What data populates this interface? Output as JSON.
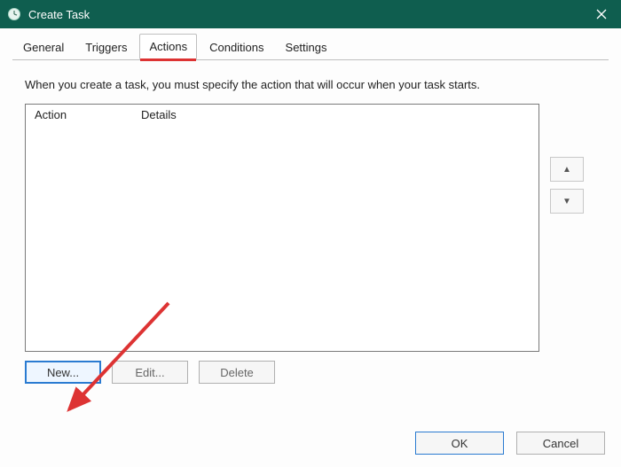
{
  "window": {
    "title": "Create Task"
  },
  "tabs": {
    "general": "General",
    "triggers": "Triggers",
    "actions": "Actions",
    "conditions": "Conditions",
    "settings": "Settings",
    "active": "actions"
  },
  "description": "When you create a task, you must specify the action that will occur when your task starts.",
  "list": {
    "col_action": "Action",
    "col_details": "Details"
  },
  "buttons": {
    "new": "New...",
    "edit": "Edit...",
    "delete": "Delete",
    "ok": "OK",
    "cancel": "Cancel"
  },
  "annotation": {
    "highlight_tab": "actions",
    "arrow_target": "new-button"
  }
}
